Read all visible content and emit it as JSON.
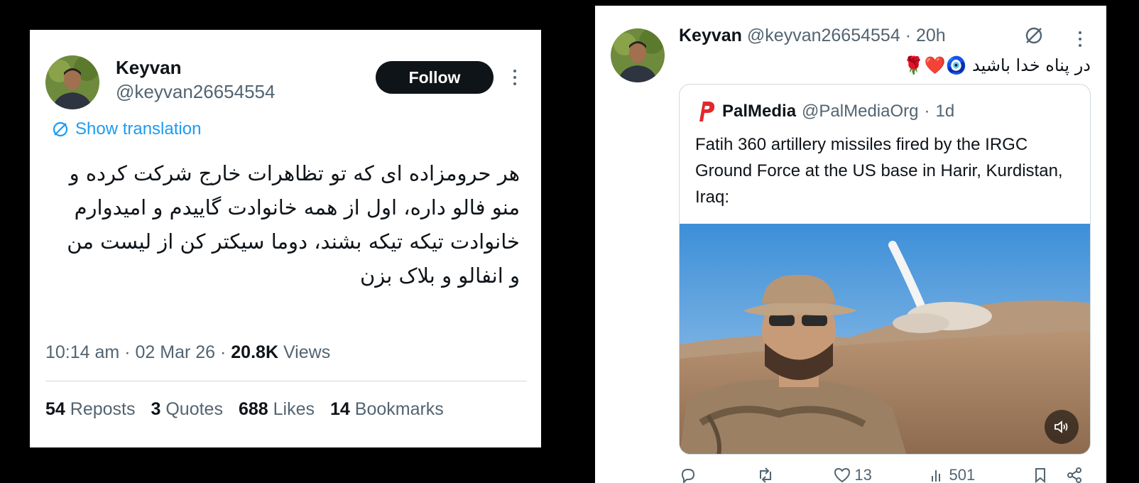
{
  "left_post": {
    "author_name": "Keyvan",
    "handle": "@keyvan26654554",
    "follow_label": "Follow",
    "translation_label": "Show translation",
    "body": "هر حرومزاده ای که تو تظاهرات خارج شرکت کرده و منو فالو داره، اول از همه خانوادت گاییدم و امیدوارم خانوادت تیکه تیکه بشند، دوما سیکتر کن از لیست من و انفالو و بلاک بزن",
    "time": "10:14 am",
    "date": "02 Mar 26",
    "views_count": "20.8K",
    "views_label": "Views",
    "stats": [
      {
        "count": "54",
        "label": "Reposts"
      },
      {
        "count": "3",
        "label": "Quotes"
      },
      {
        "count": "688",
        "label": "Likes"
      },
      {
        "count": "14",
        "label": "Bookmarks"
      }
    ]
  },
  "right_post": {
    "author_name": "Keyvan",
    "handle": "@keyvan26654554",
    "age": "20h",
    "body": "در پناه خدا باشید 🧿❤️🌹",
    "quoted": {
      "author_name": "PalMedia",
      "handle": "@PalMediaOrg",
      "age": "1d",
      "text": "Fatih 360 artillery missiles fired by the IRGC Ground Force at the US base in Harir, Kurdistan, Iraq:"
    },
    "actions": {
      "reply_count": "",
      "repost_count": "",
      "like_count": "13",
      "views_count": "501"
    }
  },
  "colors": {
    "link": "#1d9bf0",
    "muted": "#536471",
    "text": "#0f1419",
    "brand_red": "#e0282e"
  },
  "icons": [
    "grok-icon",
    "more-icon",
    "translate-icon",
    "reply-icon",
    "repost-icon",
    "like-icon",
    "views-icon",
    "bookmark-icon",
    "share-icon",
    "volume-icon",
    "palmedia-logo-icon"
  ]
}
